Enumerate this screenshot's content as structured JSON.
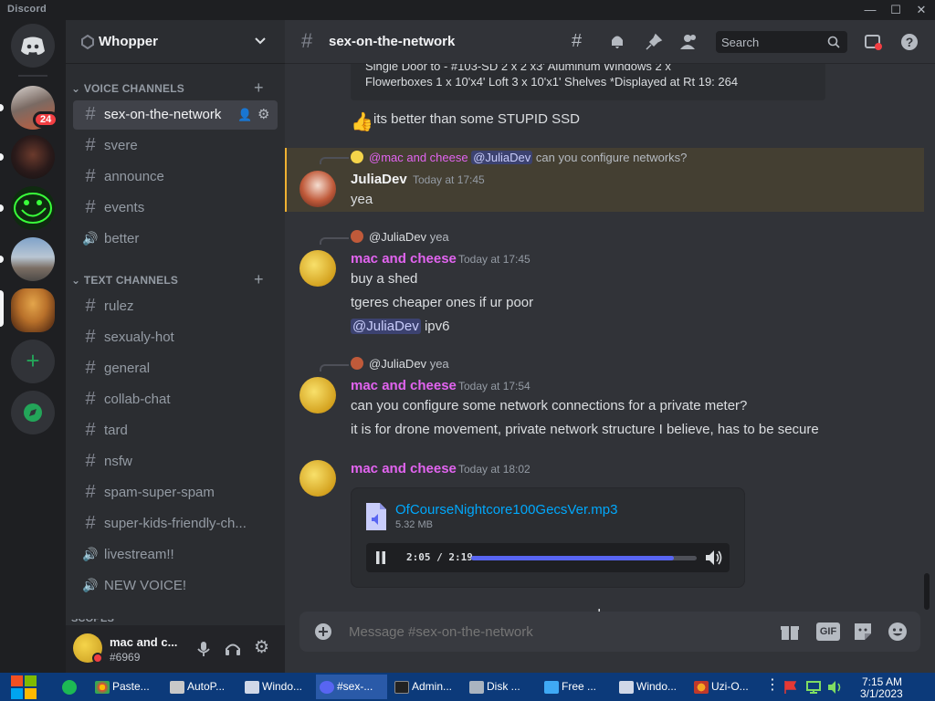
{
  "app": {
    "title": "Discord"
  },
  "window_controls": {
    "minimize": "—",
    "maximize": "☐",
    "close": "✕"
  },
  "guilds": {
    "mention_badge": "24"
  },
  "server": {
    "name": "Whopper"
  },
  "categories": {
    "voice": "VOICE CHANNELS",
    "text": "TEXT CHANNELS",
    "cut": "SCOPES"
  },
  "voice_channels": [
    {
      "label": "sex-on-the-network",
      "glyph": "#"
    },
    {
      "label": "svere",
      "glyph": "#"
    },
    {
      "label": "announce",
      "glyph": "#"
    },
    {
      "label": "events",
      "glyph": "#"
    },
    {
      "label": "better",
      "glyph": "🔊"
    }
  ],
  "text_channels": [
    {
      "label": "rulez",
      "glyph": "#"
    },
    {
      "label": "sexualy-hot",
      "glyph": "#"
    },
    {
      "label": "general",
      "glyph": "#"
    },
    {
      "label": "collab-chat",
      "glyph": "#"
    },
    {
      "label": "tard",
      "glyph": "#"
    },
    {
      "label": "nsfw",
      "glyph": "#"
    },
    {
      "label": "spam-super-spam",
      "glyph": "#"
    },
    {
      "label": "super-kids-friendly-ch...",
      "glyph": "#"
    },
    {
      "label": "livestream!!",
      "glyph": "🔊"
    },
    {
      "label": "NEW VOICE!",
      "glyph": "🔊"
    }
  ],
  "user": {
    "name": "mac and c...",
    "tag": "#6969"
  },
  "channel_header": {
    "name": "sex-on-the-network",
    "search_placeholder": "Search"
  },
  "embed": {
    "line1": "Single Door to - #103-SD 2 x 2 x3' Aluminum Windows 2 x",
    "line2": "Flowerboxes 1 x 10'x4' Loft 3 x 10'x1' Shelves *Displayed at Rt 19: 264"
  },
  "messages": {
    "m0_text": "its better than some STUPID SSD",
    "m1": {
      "reply_author": "@mac and cheese",
      "reply_mention": "@JuliaDev",
      "reply_text": "can you configure networks?",
      "author": "JuliaDev",
      "time": "Today at 17:45",
      "text": "yea"
    },
    "m2": {
      "reply_author": "@JuliaDev",
      "reply_text": "yea",
      "author": "mac and cheese",
      "time": "Today at 17:45",
      "lines": [
        "buy a shed",
        "tgeres cheaper ones if ur poor"
      ],
      "mention": "@JuliaDev",
      "mention_tail": "ipv6"
    },
    "m3": {
      "reply_author": "@JuliaDev",
      "reply_text": "yea",
      "author": "mac and cheese",
      "time": "Today at 17:54",
      "lines": [
        "can you configure some network connections for a private meter?",
        "it is for drone movement, private network structure I believe, has to be secure"
      ]
    },
    "m4": {
      "author": "mac and cheese",
      "time": "Today at 18:02",
      "file_name": "OfCourseNightcore100GecsVer.mp3",
      "file_size": "5.32 MB",
      "time_display": "2:05 / 2:19",
      "progress": 0.9
    }
  },
  "composer": {
    "placeholder": "Message #sex-on-the-network",
    "gif": "GIF"
  },
  "taskbar": {
    "items": [
      "Paste...",
      "AutoP...",
      "Windo...",
      "#sex-...",
      "Admin...",
      "Disk ...",
      "Free ...",
      "Windo...",
      "Uzi-O..."
    ],
    "time": "7:15 AM",
    "date": "3/1/2023"
  },
  "colors": {
    "accent": "#5865f2",
    "mac_name": "#e264f0",
    "juliadev_name": "#f2f3f5",
    "link": "#00a8fc",
    "online": "#23a559",
    "dnd": "#f23f43"
  }
}
